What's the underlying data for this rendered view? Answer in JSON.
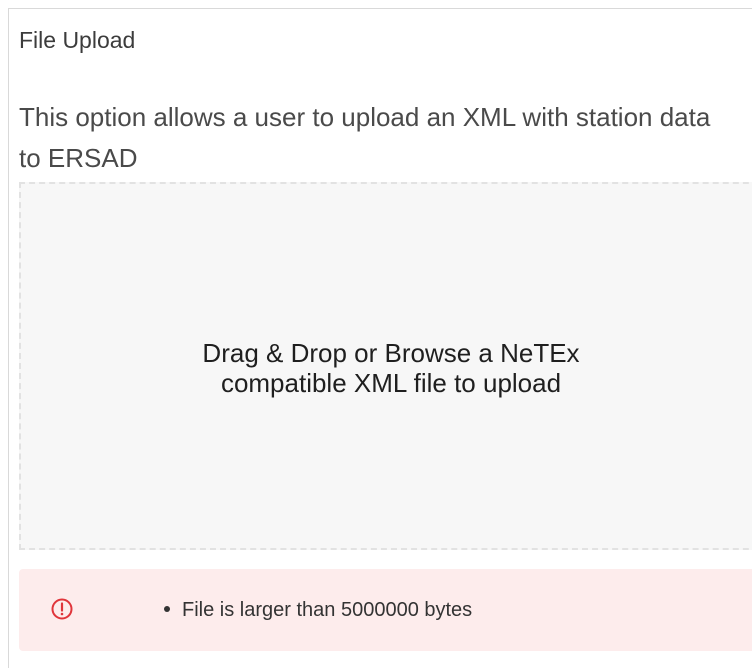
{
  "panel": {
    "title": "File Upload",
    "description": "This option allows a user to upload an XML with station data to ERSAD"
  },
  "dropzone": {
    "line1": "Drag & Drop or Browse a NeTEx",
    "line2": "compatible XML file to upload"
  },
  "error": {
    "icon": "exclamation-circle-icon",
    "messages": [
      "File is larger than 5000000 bytes"
    ],
    "color": "#e0353b",
    "background": "#fdecec"
  }
}
